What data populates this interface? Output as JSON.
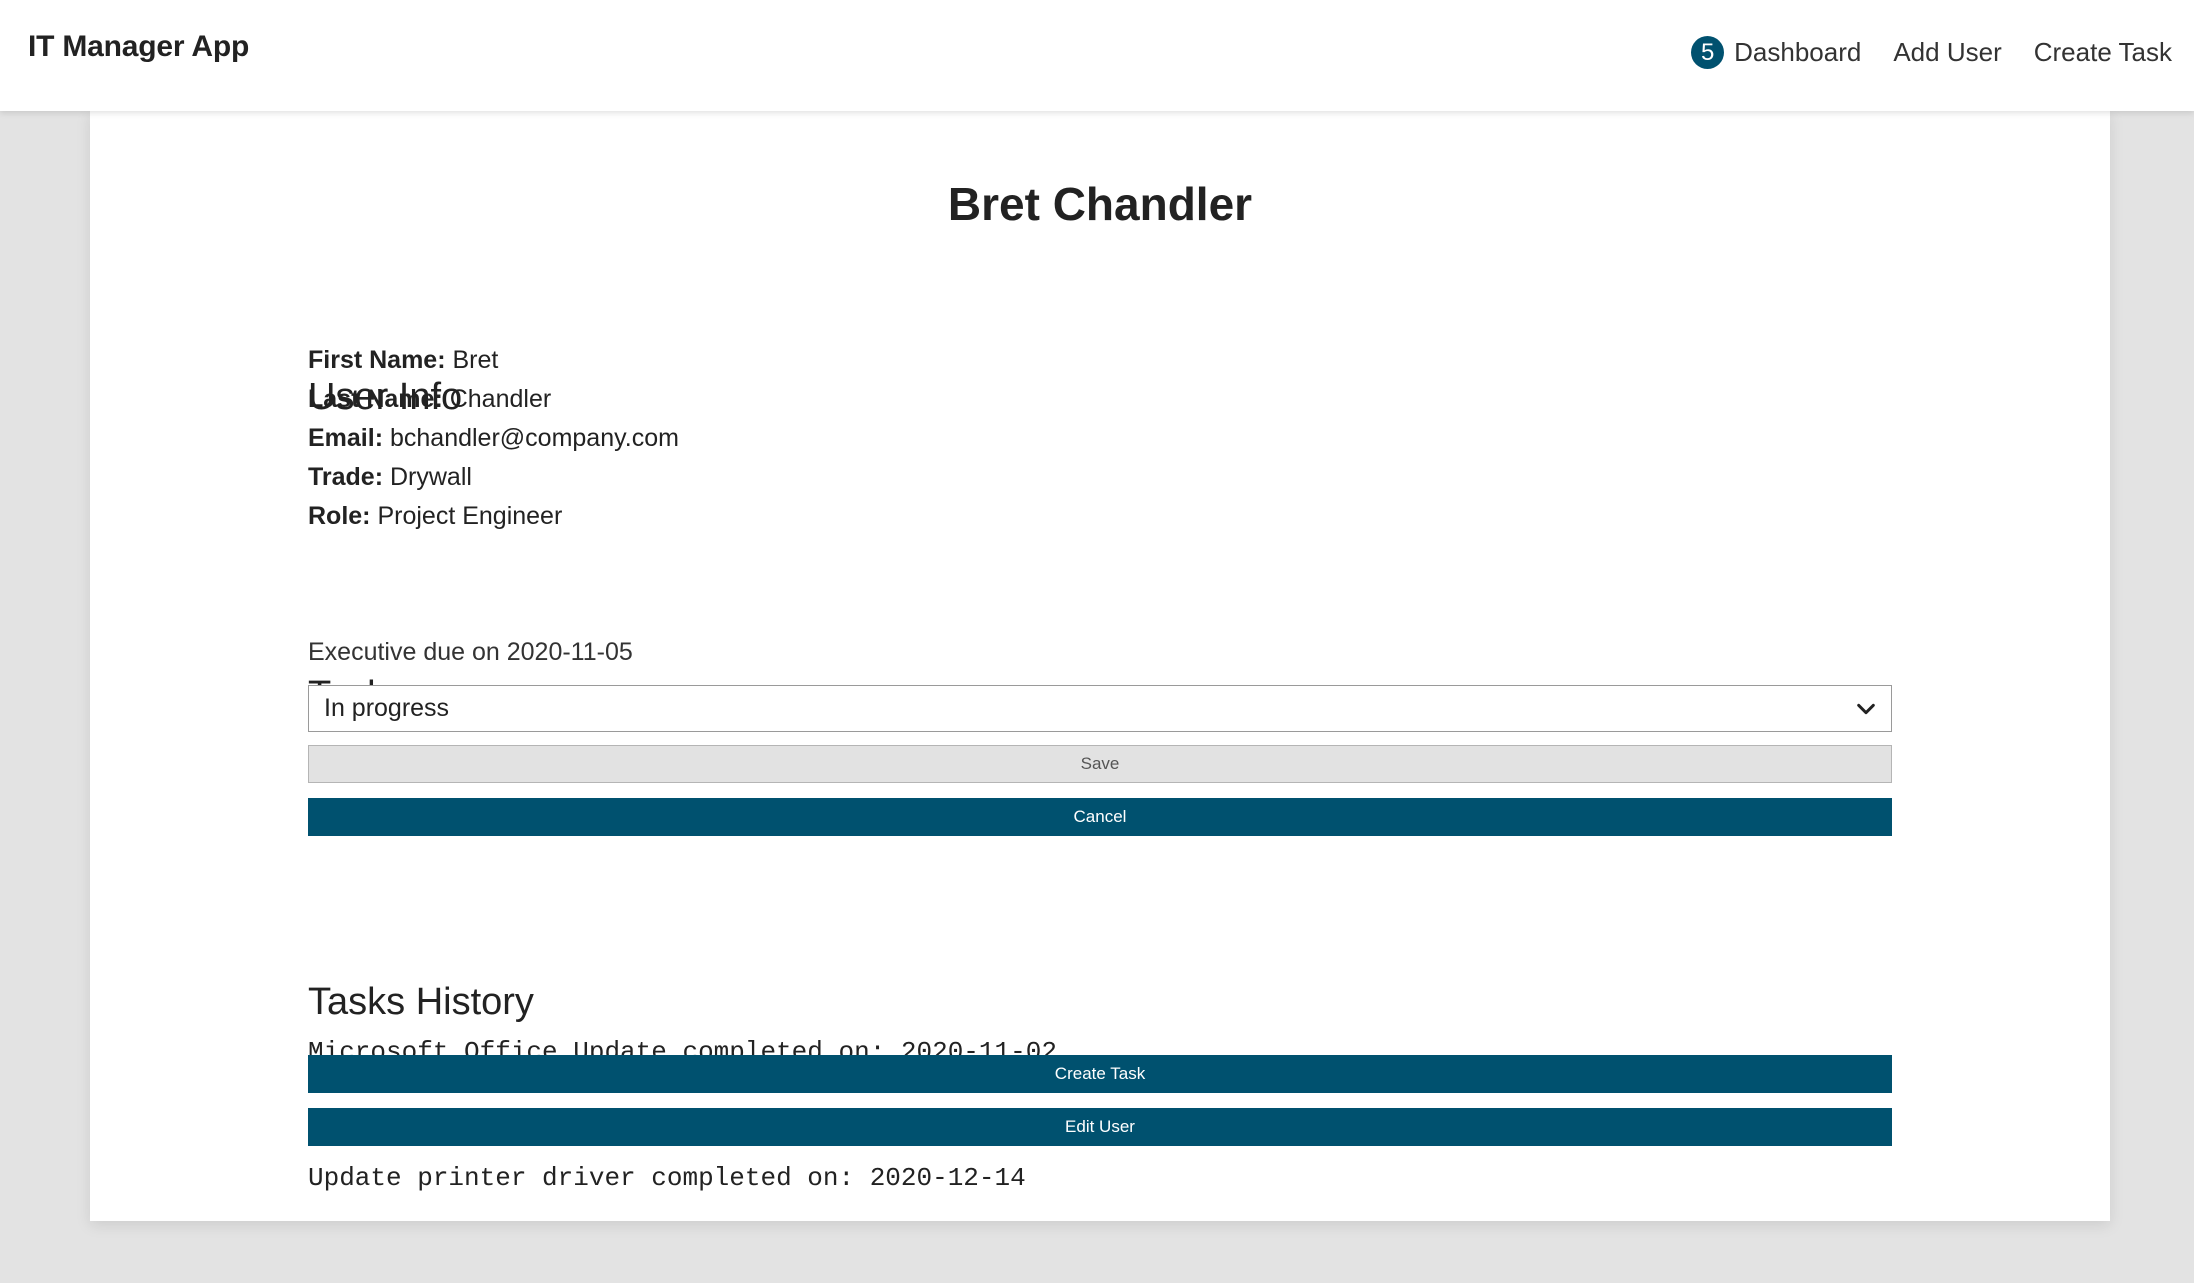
{
  "navbar": {
    "brand": "IT Manager App",
    "links": [
      {
        "label": "Dashboard",
        "badge": "5"
      },
      {
        "label": "Add User"
      },
      {
        "label": "Create Task"
      }
    ]
  },
  "user": {
    "full_name": "Bret Chandler",
    "info_heading": "User Info",
    "fields": [
      {
        "label": "First Name:",
        "value": "Bret"
      },
      {
        "label": "Last Name:",
        "value": "Chandler"
      },
      {
        "label": "Email:",
        "value": "bchandler@company.com"
      },
      {
        "label": "Trade:",
        "value": "Drywall"
      },
      {
        "label": "Role:",
        "value": "Project Engineer"
      }
    ]
  },
  "tasks": {
    "heading": "Tasks",
    "current_task": "Executive due on 2020-11-05",
    "status_selected": "In progress",
    "save_label": "Save",
    "cancel_label": "Cancel"
  },
  "history": {
    "heading": "Tasks History",
    "items": [
      "Microsoft Office Update completed on: 2020-11-02",
      "Update printer driver completed on: 2020-12-14"
    ]
  },
  "actions": {
    "create_task_label": "Create Task",
    "edit_user_label": "Edit User"
  },
  "colors": {
    "primary": "#00516f",
    "background": "#e3e3e3",
    "card": "#ffffff"
  }
}
